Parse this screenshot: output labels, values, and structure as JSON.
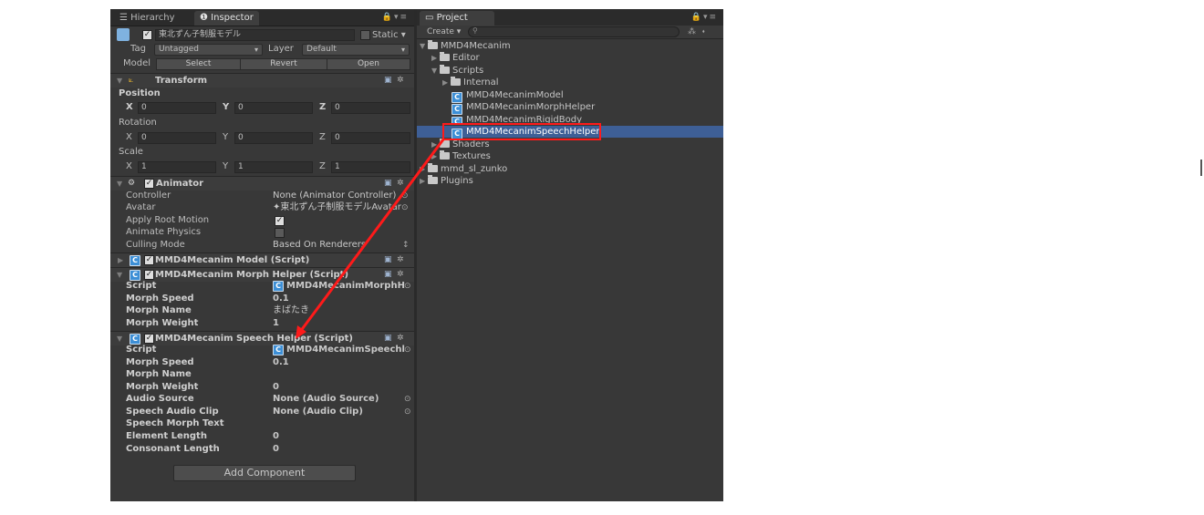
{
  "tabs": {
    "hierarchy": "Hierarchy",
    "inspector": "Inspector",
    "project": "Project"
  },
  "object": {
    "name": "東北ずん子制服モデル",
    "static_label": "Static",
    "tag_label": "Tag",
    "tag_value": "Untagged",
    "layer_label": "Layer",
    "layer_value": "Default",
    "model_label": "Model",
    "model_buttons": [
      "Select",
      "Revert",
      "Open"
    ]
  },
  "transform": {
    "title": "Transform",
    "position_label": "Position",
    "rotation_label": "Rotation",
    "scale_label": "Scale",
    "axes": [
      "X",
      "Y",
      "Z"
    ],
    "position": [
      "0",
      "0",
      "0"
    ],
    "rotation": [
      "0",
      "0",
      "0"
    ],
    "scale": [
      "1",
      "1",
      "1"
    ]
  },
  "animator": {
    "title": "Animator",
    "rows": [
      {
        "label": "Controller",
        "value": "None (Animator Controller)"
      },
      {
        "label": "Avatar",
        "value": "東北ずん子制服モデルAvatar"
      },
      {
        "label": "Apply Root Motion",
        "value": ""
      },
      {
        "label": "Animate Physics",
        "value": ""
      },
      {
        "label": "Culling Mode",
        "value": "Based On Renderers"
      }
    ]
  },
  "model_script": {
    "title": "MMD4Mecanim Model (Script)"
  },
  "morph_helper": {
    "title": "MMD4Mecanim Morph Helper (Script)",
    "rows": [
      {
        "label": "Script",
        "value": "MMD4MecanimMorphH"
      },
      {
        "label": "Morph Speed",
        "value": "0.1"
      },
      {
        "label": "Morph Name",
        "value": "まばたき"
      },
      {
        "label": "Morph Weight",
        "value": "1"
      }
    ]
  },
  "speech_helper": {
    "title": "MMD4Mecanim Speech Helper (Script)",
    "rows": [
      {
        "label": "Script",
        "value": "MMD4MecanimSpeechl"
      },
      {
        "label": "Morph Speed",
        "value": "0.1"
      },
      {
        "label": "Morph Name",
        "value": ""
      },
      {
        "label": "Morph Weight",
        "value": "0"
      },
      {
        "label": "Audio Source",
        "value": "None (Audio Source)"
      },
      {
        "label": "Speech Audio Clip",
        "value": "None (Audio Clip)"
      },
      {
        "label": "Speech Morph Text",
        "value": ""
      },
      {
        "label": "Element Length",
        "value": "0"
      },
      {
        "label": "Consonant Length",
        "value": "0"
      }
    ]
  },
  "add_component": "Add Component",
  "project": {
    "create_label": "Create",
    "tree": [
      "MMD4Mecanim",
      "Editor",
      "Scripts",
      "Internal",
      "MMD4MecanimModel",
      "MMD4MecanimMorphHelper",
      "MMD4MecanimRigidBody",
      "MMD4MecanimSpeechHelper",
      "Shaders",
      "Textures",
      "mmd_sl_zunko",
      "Plugins"
    ]
  },
  "colors": {
    "highlight": "#ff1a1a",
    "selection": "#3e5f96",
    "script_icon": "#3d8fd6"
  }
}
